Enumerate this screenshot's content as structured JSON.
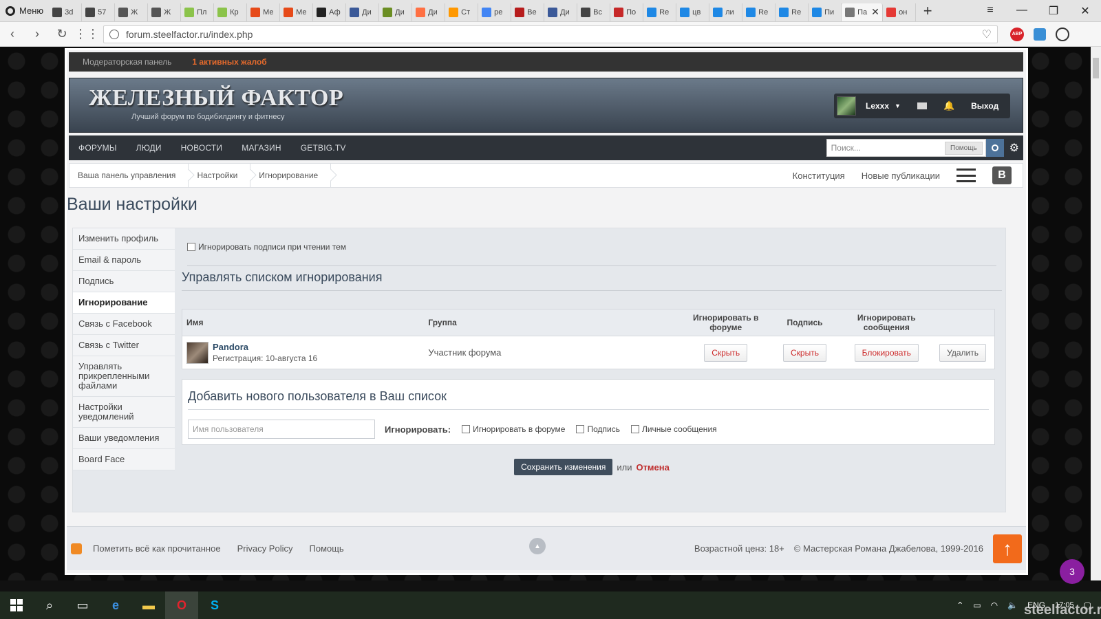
{
  "browser": {
    "menu_label": "Меню",
    "tabs": [
      {
        "label": "3d",
        "color": "#444"
      },
      {
        "label": "57",
        "color": "#444"
      },
      {
        "label": "Ж",
        "color": "#555"
      },
      {
        "label": "Ж",
        "color": "#555"
      },
      {
        "label": "Пл",
        "color": "#8bc34a"
      },
      {
        "label": "Кр",
        "color": "#8bc34a"
      },
      {
        "label": "Ме",
        "color": "#e64a19"
      },
      {
        "label": "Ме",
        "color": "#e64a19"
      },
      {
        "label": "Аф",
        "color": "#222"
      },
      {
        "label": "Ди",
        "color": "#3b5998"
      },
      {
        "label": "Ди",
        "color": "#6b8e23"
      },
      {
        "label": "Ди",
        "color": "#ff7043"
      },
      {
        "label": "Ст",
        "color": "#ff9800"
      },
      {
        "label": "ре",
        "color": "#4285f4"
      },
      {
        "label": "Ве",
        "color": "#b71c1c"
      },
      {
        "label": "Ди",
        "color": "#3b5998"
      },
      {
        "label": "Вс",
        "color": "#444"
      },
      {
        "label": "По",
        "color": "#c62828"
      },
      {
        "label": "Re",
        "color": "#1e88e5"
      },
      {
        "label": "цв",
        "color": "#1e88e5"
      },
      {
        "label": "ли",
        "color": "#1e88e5"
      },
      {
        "label": "Re",
        "color": "#1e88e5"
      },
      {
        "label": "Re",
        "color": "#1e88e5"
      },
      {
        "label": "Пи",
        "color": "#1e88e5"
      }
    ],
    "active_tab": {
      "label": "Па"
    },
    "last_tab": {
      "label": "он"
    },
    "url": "forum.steelfactor.ru/index.php",
    "abp_label": "ABP"
  },
  "modbar": {
    "panel": "Модераторская панель",
    "alerts": "1 активных жалоб"
  },
  "header": {
    "logo": "ЖЕЛЕЗНЫЙ ФАКТОР",
    "tagline": "Лучший форум по бодибилдингу и фитнесу",
    "username": "Lexxx",
    "logout": "Выход"
  },
  "nav": {
    "items": [
      "Форумы",
      "Люди",
      "Новости",
      "Магазин",
      "GetBig.TV"
    ],
    "search_placeholder": "Поиск...",
    "help_label": "Помощь"
  },
  "breadcrumb": {
    "items": [
      "Ваша панель управления",
      "Настройки",
      "Игнорирование"
    ],
    "right_links": [
      "Конституция",
      "Новые публикации"
    ],
    "vk_label": "B"
  },
  "page_title": "Ваши настройки",
  "sidebar": {
    "items": [
      {
        "label": "Изменить профиль"
      },
      {
        "label": "Email & пароль"
      },
      {
        "label": "Подпись"
      },
      {
        "label": "Игнорирование"
      },
      {
        "label": "Связь с Facebook"
      },
      {
        "label": "Связь с Twitter"
      },
      {
        "label": "Управлять прикрепленными файлами"
      },
      {
        "label": "Настройки уведомлений"
      },
      {
        "label": "Ваши уведомления"
      },
      {
        "label": "Board Face"
      }
    ]
  },
  "settings": {
    "ignore_signatures": "Игнорировать подписи при чтении тем",
    "manage_title": "Управлять списком игнорирования"
  },
  "table": {
    "headers": [
      "Имя",
      "Группа",
      "Игнорировать в форуме",
      "Подпись",
      "Игнорировать сообщения"
    ],
    "rows": [
      {
        "name": "Pandora",
        "registered": "Регистрация: 10-августа 16",
        "group": "Участник форума",
        "forum_btn": "Скрыть",
        "sig_btn": "Скрыть",
        "msg_btn": "Блокировать",
        "delete_btn": "Удалить"
      }
    ]
  },
  "add_user": {
    "title": "Добавить нового пользователя в Ваш список",
    "placeholder": "Имя пользователя",
    "ignore_label": "Игнорировать:",
    "options": [
      "Игнорировать в форуме",
      "Подпись",
      "Личные сообщения"
    ]
  },
  "actions": {
    "save": "Сохранить изменения",
    "or": "или",
    "cancel": "Отмена"
  },
  "footer": {
    "mark_read": "Пометить всё как прочитанное",
    "privacy": "Privacy Policy",
    "help": "Помощь",
    "age": "Возрастной ценз: 18+",
    "copyright": "© Мастерская Романа Джабелова, 1999-2016"
  },
  "notification_badge": "3",
  "taskbar": {
    "lang": "ENG",
    "time": "17:05"
  },
  "watermark": "steelfactor.ru"
}
